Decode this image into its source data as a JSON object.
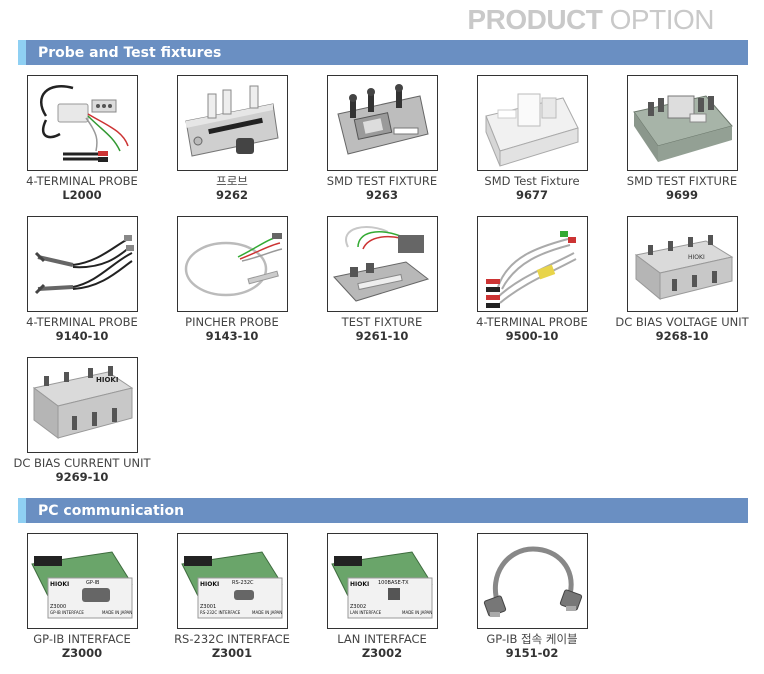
{
  "header": {
    "title_bold": "PRODUCT",
    "title_light": "OPTION"
  },
  "sections": [
    {
      "title": "Probe and Test fixtures",
      "items": [
        {
          "caption": "4-TERMINAL PROBE",
          "code": "L2000"
        },
        {
          "caption": "프로브",
          "code": "9262"
        },
        {
          "caption": "SMD TEST FIXTURE",
          "code": "9263"
        },
        {
          "caption": "SMD Test Fixture",
          "code": "9677"
        },
        {
          "caption": "SMD TEST FIXTURE",
          "code": "9699"
        },
        {
          "caption": "4-TERMINAL PROBE",
          "code": "9140-10"
        },
        {
          "caption": "PINCHER PROBE",
          "code": "9143-10"
        },
        {
          "caption": "TEST FIXTURE",
          "code": "9261-10"
        },
        {
          "caption": "4-TERMINAL PROBE",
          "code": "9500-10"
        },
        {
          "caption": "DC BIAS VOLTAGE UNIT",
          "code": "9268-10"
        },
        {
          "caption": "DC BIAS CURRENT UNIT",
          "code": "9269-10"
        }
      ]
    },
    {
      "title": "PC communication",
      "items": [
        {
          "caption": "GP-IB INTERFACE",
          "code": "Z3000",
          "board_label": "GP-IB",
          "board_model": "Z3000",
          "board_iface": "GP-IB INTERFACE"
        },
        {
          "caption": "RS-232C INTERFACE",
          "code": "Z3001",
          "board_label": "RS-232C",
          "board_model": "Z3001",
          "board_iface": "RS-232C INTERFACE"
        },
        {
          "caption": "LAN INTERFACE",
          "code": "Z3002",
          "board_label": "100BASE-TX",
          "board_model": "Z3002",
          "board_iface": "LAN INTERFACE"
        },
        {
          "caption": "GP-IB 접속 케이블",
          "code": "9151-02"
        }
      ]
    }
  ],
  "brand": {
    "logo_text": "HIOKI",
    "made_in": "MADE IN JAPAN"
  },
  "colors": {
    "section_bar": "#6a8fc2",
    "section_mark": "#8fd0f3",
    "title_gray": "#c9c9c9"
  }
}
